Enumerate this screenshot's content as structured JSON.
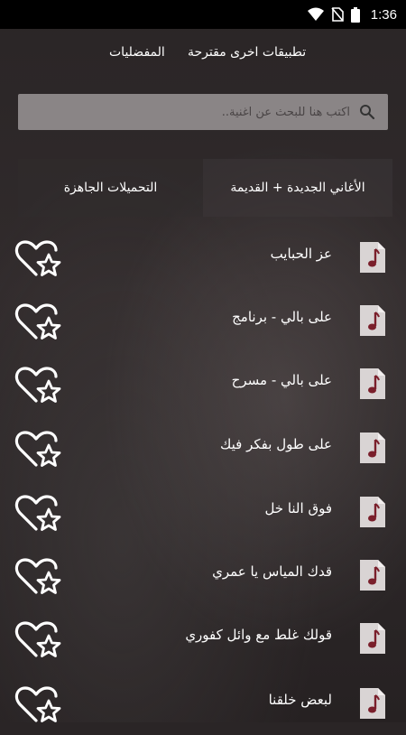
{
  "status_bar": {
    "time": "1:36",
    "icons": [
      "wifi-icon",
      "no-sim-icon",
      "battery-icon"
    ]
  },
  "nav": {
    "suggested": "تطبيقات اخرى مقترحة",
    "favorites": "المفضليات"
  },
  "search": {
    "placeholder": "اكتب هنا للبحث عن اغنية..",
    "icon": "search-icon"
  },
  "tabs": {
    "new_old": "الأغاني الجديدة + القديمة",
    "downloads": "التحميلات الجاهزة"
  },
  "songs": [
    {
      "title": "عز الحبايب"
    },
    {
      "title": "على بالي - برنامج"
    },
    {
      "title": "على بالي - مسرح"
    },
    {
      "title": "على طول بفكر فيك"
    },
    {
      "title": "فوق النا خل"
    },
    {
      "title": "قدك المياس يا عمري"
    },
    {
      "title": "قولك غلط مع وائل كفوري"
    },
    {
      "title": "لبعض خلقنا"
    }
  ],
  "colors": {
    "search_bg": "#8a8586",
    "note_icon": "#7a1f2b"
  }
}
